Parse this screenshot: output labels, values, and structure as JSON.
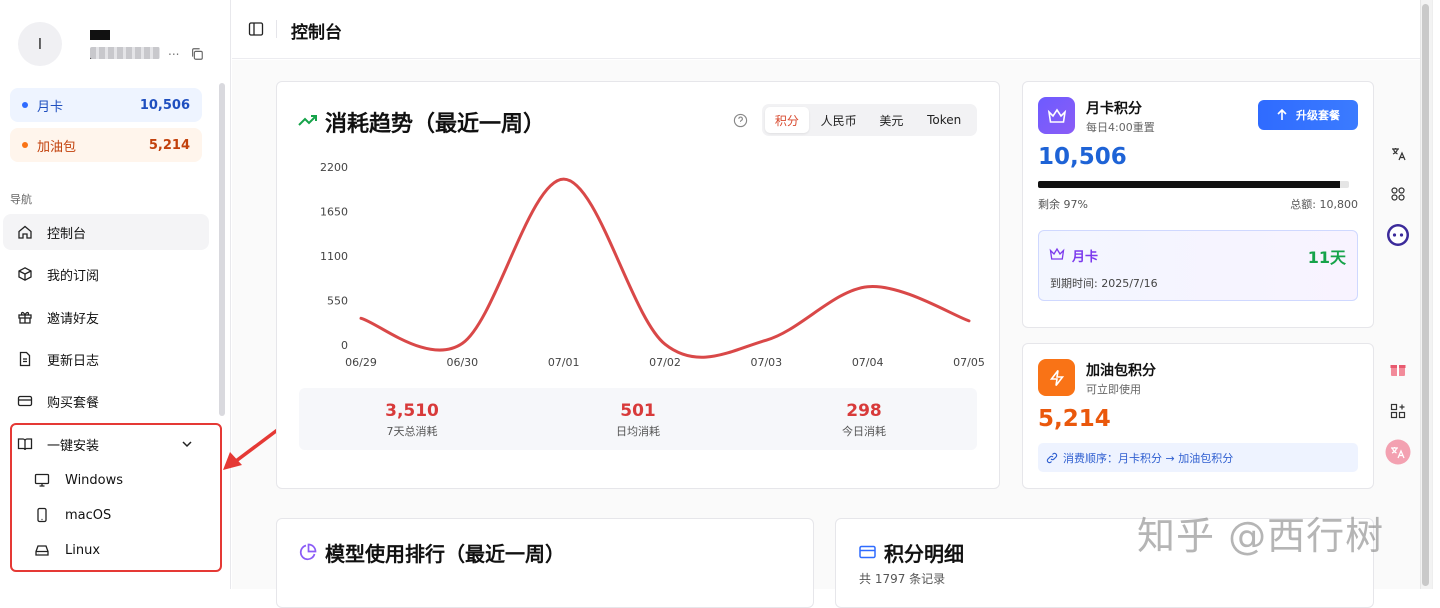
{
  "user": {
    "avatar_letter": "I",
    "email_suffix": "..."
  },
  "plans": [
    {
      "label": "月卡",
      "value": "10,506"
    },
    {
      "label": "加油包",
      "value": "5,214"
    }
  ],
  "nav": {
    "section_title": "导航",
    "items": [
      {
        "label": "控制台",
        "icon": "home-icon"
      },
      {
        "label": "我的订阅",
        "icon": "box-icon"
      },
      {
        "label": "邀请好友",
        "icon": "gift-icon"
      },
      {
        "label": "更新日志",
        "icon": "document-icon"
      },
      {
        "label": "购买套餐",
        "icon": "credit-card-icon"
      }
    ],
    "install": {
      "label": "一键安装",
      "children": [
        {
          "label": "Windows",
          "icon": "monitor-icon"
        },
        {
          "label": "macOS",
          "icon": "phone-icon"
        },
        {
          "label": "Linux",
          "icon": "drive-icon"
        }
      ]
    }
  },
  "header": {
    "title": "控制台"
  },
  "trend": {
    "title": "消耗趋势（最近一周）",
    "tabs": [
      "积分",
      "人民币",
      "美元",
      "Token"
    ],
    "active_tab": "积分",
    "stats": [
      {
        "value": "3,510",
        "label": "7天总消耗"
      },
      {
        "value": "501",
        "label": "日均消耗"
      },
      {
        "value": "298",
        "label": "今日消耗"
      }
    ]
  },
  "chart_data": {
    "type": "line",
    "x": [
      "06/29",
      "06/30",
      "07/01",
      "07/02",
      "07/03",
      "07/04",
      "07/05"
    ],
    "y_ticks": [
      "0",
      "550",
      "1100",
      "1650",
      "2200"
    ],
    "ylim": [
      0,
      2200
    ],
    "series": [
      {
        "values": [
          330,
          20,
          2050,
          10,
          60,
          720,
          298
        ],
        "color": "#d94848"
      }
    ],
    "grid": false
  },
  "month_card": {
    "title": "月卡积分",
    "subtitle": "每日4:00重置",
    "upgrade_label": "升级套餐",
    "value": "10,506",
    "remaining_fraction": 0.97,
    "remaining_label": "剩余 97%",
    "total_label": "总额: 10,800",
    "plan_label": "月卡",
    "days_left": "11天",
    "expiry": "到期时间: 2025/7/16"
  },
  "fuel_card": {
    "title": "加油包积分",
    "subtitle": "可立即使用",
    "value": "5,214",
    "order": "消费顺序：月卡积分 → 加油包积分"
  },
  "ranking": {
    "title": "模型使用排行（最近一周）"
  },
  "detail": {
    "title": "积分明细",
    "subtitle": "共 1797 条记录"
  },
  "watermark": "知乎 @西行树",
  "colors": {
    "accent_red": "#d94848",
    "accent_blue": "#1e63d6",
    "orange": "#ea580c",
    "green": "#16a34a",
    "purple": "#7c3aed"
  }
}
